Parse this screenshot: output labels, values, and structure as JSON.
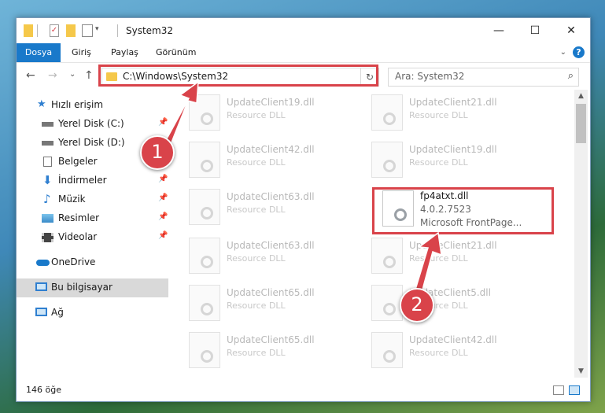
{
  "window": {
    "title": "System32",
    "controls": {
      "minimize": "—",
      "maximize": "☐",
      "close": "✕"
    }
  },
  "ribbon": {
    "tabs": [
      {
        "label": "Dosya"
      },
      {
        "label": "Giriş"
      },
      {
        "label": "Paylaş"
      },
      {
        "label": "Görünüm"
      }
    ],
    "help": "?"
  },
  "navigation": {
    "back": "←",
    "forward": "→",
    "recent": "⌄",
    "up": "↑",
    "address": "C:\\Windows\\System32",
    "search_placeholder": "Ara: System32"
  },
  "sidebar": {
    "items": [
      {
        "label": "Hızlı erişim"
      },
      {
        "label": "Yerel Disk (C:)"
      },
      {
        "label": "Yerel Disk (D:)"
      },
      {
        "label": "Belgeler"
      },
      {
        "label": "İndirmeler"
      },
      {
        "label": "Müzik"
      },
      {
        "label": "Resimler"
      },
      {
        "label": "Videolar"
      },
      {
        "label": "OneDrive"
      },
      {
        "label": "Bu bilgisayar"
      },
      {
        "label": "Ağ"
      }
    ]
  },
  "files": {
    "left": [
      {
        "name": "UpdateClient19.dll",
        "type": "Resource DLL"
      },
      {
        "name": "UpdateClient42.dll",
        "type": "Resource DLL"
      },
      {
        "name": "UpdateClient63.dll",
        "type": "Resource DLL"
      },
      {
        "name": "UpdateClient63.dll",
        "type": "Resource DLL"
      },
      {
        "name": "UpdateClient65.dll",
        "type": "Resource DLL"
      },
      {
        "name": "UpdateClient65.dll",
        "type": "Resource DLL"
      }
    ],
    "right": [
      {
        "name": "UpdateClient21.dll",
        "type": "Resource DLL"
      },
      {
        "name": "UpdateClient19.dll",
        "type": "Resource DLL"
      },
      {
        "name": "UpdateClient21.dll",
        "type": "Resource DLL"
      },
      {
        "name": "UpdateClient5.dll",
        "type": "Resource DLL"
      },
      {
        "name": "UpdateClient42.dll",
        "type": "Resource DLL"
      }
    ],
    "highlighted": {
      "name": "fp4atxt.dll",
      "version": "4.0.2.7523",
      "type": "Microsoft FrontPage..."
    }
  },
  "status": {
    "item_count": "146 öğe"
  },
  "annotations": {
    "step1": "1",
    "step2": "2",
    "accent": "#d9434a"
  }
}
